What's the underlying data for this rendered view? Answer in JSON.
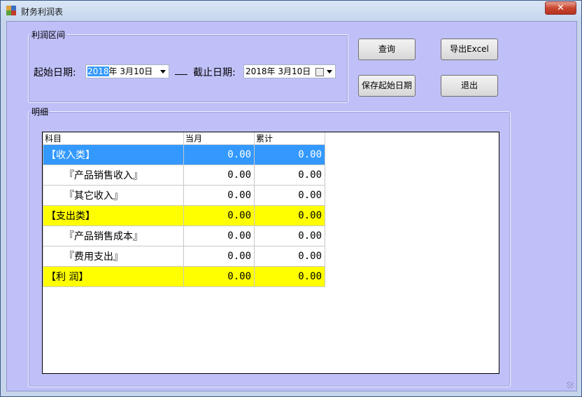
{
  "window": {
    "title": "财务利润表",
    "close_label": "✕"
  },
  "range_group": {
    "legend": "利润区间",
    "start_label": "起始日期:",
    "start_year": "2018",
    "start_rest": "年  3月10日",
    "end_label": "截止日期:",
    "end_value": "2018年  3月10日"
  },
  "buttons": {
    "query": "查询",
    "export": "导出Excel",
    "save_start": "保存起始日期",
    "exit": "退出"
  },
  "detail_group": {
    "legend": "明细"
  },
  "table": {
    "headers": [
      "科目",
      "当月",
      "累计"
    ],
    "rows": [
      {
        "subject": "【收入类】",
        "month": "0.00",
        "total": "0.00",
        "style": "blue"
      },
      {
        "subject": "  『产品销售收入』",
        "month": "0.00",
        "total": "0.00",
        "style": "normal"
      },
      {
        "subject": "  『其它收入』",
        "month": "0.00",
        "total": "0.00",
        "style": "normal"
      },
      {
        "subject": "【支出类】",
        "month": "0.00",
        "total": "0.00",
        "style": "yellow"
      },
      {
        "subject": "  『产品销售成本』",
        "month": "0.00",
        "total": "0.00",
        "style": "normal"
      },
      {
        "subject": "  『费用支出』",
        "month": "0.00",
        "total": "0.00",
        "style": "normal"
      },
      {
        "subject": "【利   润】",
        "month": "0.00",
        "total": "0.00",
        "style": "yellow"
      }
    ]
  },
  "colors": {
    "client_bg": "#c0c0f9",
    "highlight_blue": "#3399ff",
    "highlight_yellow": "#ffff00"
  }
}
